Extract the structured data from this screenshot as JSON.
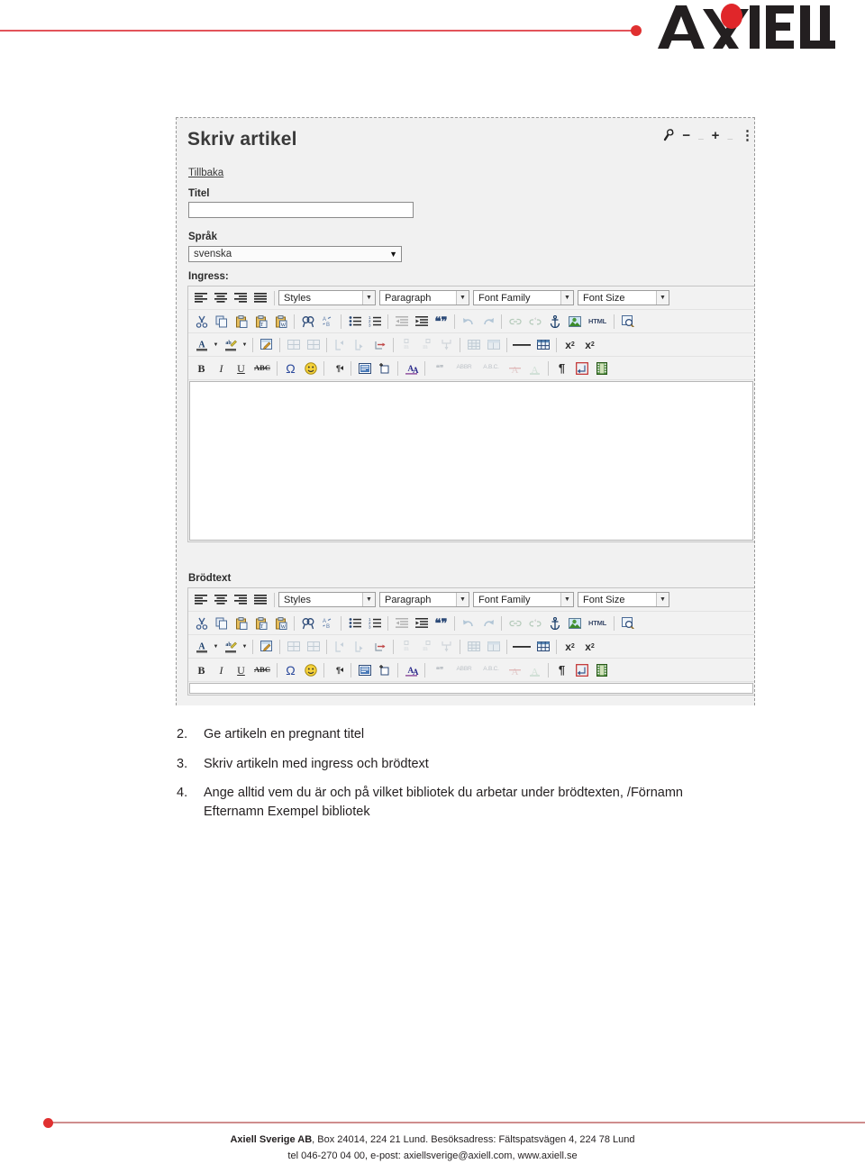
{
  "header": {
    "brand": "AXIELL",
    "accent_color": "#e2535a",
    "dot_color": "#e03030"
  },
  "screenshot": {
    "app_title": "Skriv artikel",
    "window_controls": [
      {
        "name": "wrench-icon",
        "glyph": "🔧"
      },
      {
        "name": "minimize",
        "glyph": "−"
      },
      {
        "name": "maximize",
        "glyph": "+"
      },
      {
        "name": "more",
        "glyph": "⋮"
      }
    ],
    "back_link": "Tillbaka",
    "fields": {
      "title_label": "Titel",
      "title_value": "",
      "title_placeholder": "",
      "language_label": "Språk",
      "language_value": "svenska",
      "language_options": [
        "svenska"
      ],
      "ingress_label": "Ingress:",
      "body_label": "Brödtext"
    },
    "editor": {
      "combos": {
        "styles": "Styles",
        "format": "Paragraph",
        "font_family": "Font Family",
        "font_size": "Font Size"
      },
      "content_ingress": "",
      "content_brodtext": "",
      "row1_icons": [
        "align-left-icon",
        "align-center-icon",
        "align-right-icon",
        "align-justify-icon"
      ],
      "row2_icons": [
        "cut-icon",
        "copy-icon",
        "paste-icon",
        "paste-text-icon",
        "paste-word-icon",
        "find-icon",
        "replace-icon",
        "bullet-list-icon",
        "numbered-list-icon",
        "outdent-icon",
        "indent-icon",
        "blockquote-icon",
        "undo-icon",
        "redo-icon",
        "link-icon",
        "unlink-icon",
        "anchor-icon",
        "image-icon",
        "html-icon",
        "preview-icon"
      ],
      "row3_icons": [
        "text-color-icon",
        "text-color-dropdown-icon",
        "highlight-color-icon",
        "highlight-color-dropdown-icon",
        "edit-css-icon",
        "insert-row-before-icon",
        "insert-row-after-icon",
        "delete-row-icon",
        "insert-col-before-icon",
        "insert-col-after-icon",
        "delete-col-icon",
        "merge-cells-icon",
        "split-cell-icon",
        "table-props-icon",
        "row-props-icon",
        "cell-props-icon",
        "horizontal-rule-icon",
        "insert-table-icon",
        "subscript-icon",
        "superscript-icon"
      ],
      "row4_icons": [
        "bold-icon",
        "italic-icon",
        "underline-icon",
        "strikethrough-icon",
        "special-char-icon",
        "emoticon-icon",
        "text-direction-icon",
        "fieldset-icon",
        "insert-layer-icon",
        "style-a-icon",
        "quote-icon",
        "abbr-icon",
        "acronym-icon",
        "delete-text-icon",
        "insert-text-icon",
        "pilcrow-icon",
        "nonbreaking-icon",
        "media-icon"
      ],
      "row4_labels": {
        "bold": "B",
        "italic": "I",
        "underline": "U",
        "strikethrough": "ABC",
        "special_char": "Ω",
        "quote": "❝❞",
        "abbr": "ABBR",
        "acronym": "A.B.C.",
        "pilcrow": "¶",
        "html": "HTML",
        "subscript": "x",
        "superscript": "x"
      }
    }
  },
  "instructions": [
    {
      "number": "2.",
      "text": "Ge artikeln en pregnant titel"
    },
    {
      "number": "3.",
      "text": "Skriv artikeln med ingress och brödtext"
    },
    {
      "number": "4.",
      "text": "Ange alltid vem du är och på vilket bibliotek du arbetar under brödtexten, /Förnamn Efternamn Exempel bibliotek"
    }
  ],
  "footer": {
    "company": "Axiell Sverige AB",
    "line1_rest": ", Box 24014, 224 21 Lund. Besöksadress: Fältspatsvägen 4, 224 78 Lund",
    "line2": "tel 046-270 04 00, e-post: axiellsverige@axiell.com, www.axiell.se",
    "rule_color": "#cf8d8d"
  }
}
